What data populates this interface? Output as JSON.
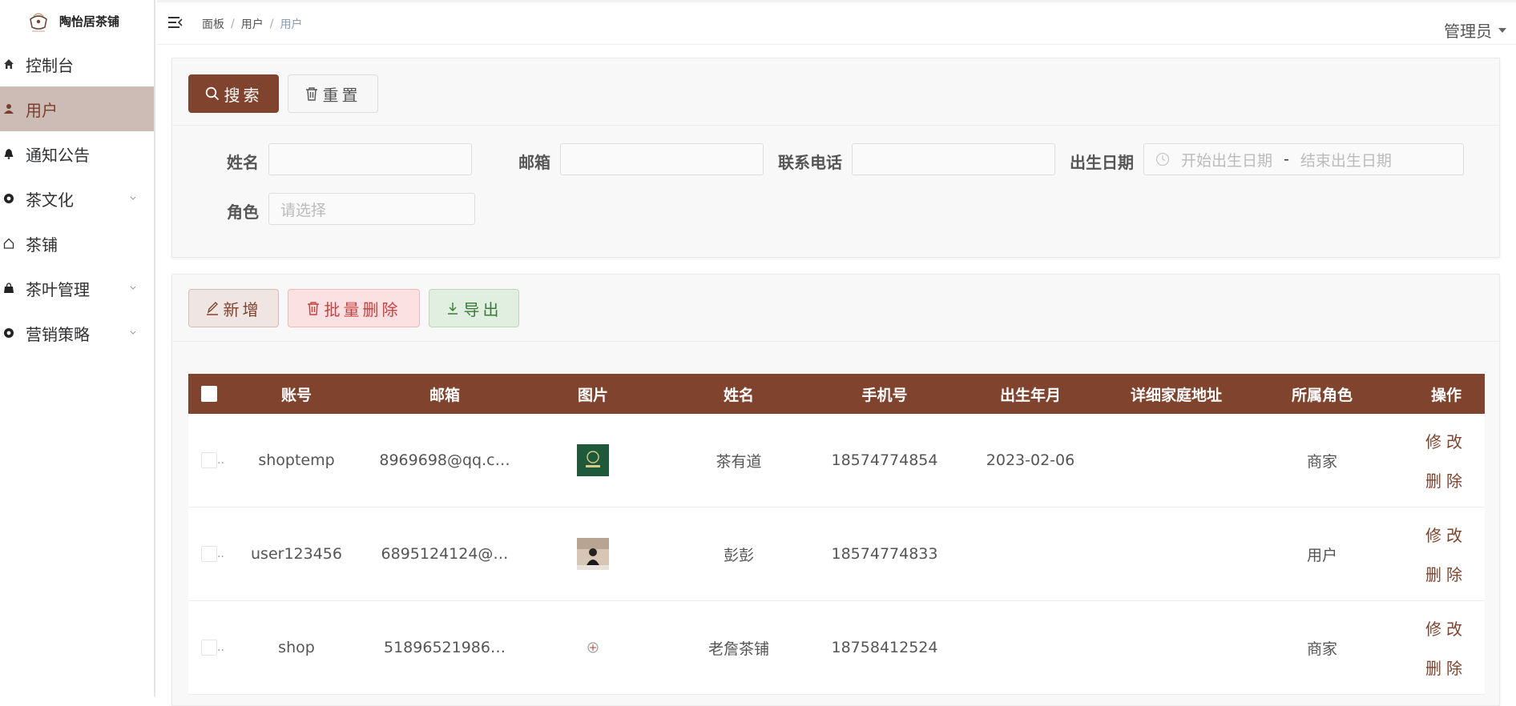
{
  "app": {
    "name": "陶怡居茶铺"
  },
  "sidebar": {
    "items": [
      {
        "label": "控制台",
        "icon": "home-icon",
        "active": false,
        "submenu": false
      },
      {
        "label": "用户",
        "icon": "user-icon",
        "active": true,
        "submenu": false
      },
      {
        "label": "通知公告",
        "icon": "bell-icon",
        "active": false,
        "submenu": false
      },
      {
        "label": "茶文化",
        "icon": "circle-icon",
        "active": false,
        "submenu": true
      },
      {
        "label": "茶铺",
        "icon": "house-icon",
        "active": false,
        "submenu": false
      },
      {
        "label": "茶叶管理",
        "icon": "bag-icon",
        "active": false,
        "submenu": true
      },
      {
        "label": "营销策略",
        "icon": "circle-icon",
        "active": false,
        "submenu": true
      }
    ]
  },
  "header": {
    "breadcrumb": [
      "面板",
      "用户",
      "用户"
    ],
    "user": "管理员"
  },
  "search": {
    "search_label": "搜索",
    "reset_label": "重置",
    "fields": {
      "name_label": "姓名",
      "email_label": "邮箱",
      "phone_label": "联系电话",
      "birth_label": "出生日期",
      "birth_start_placeholder": "开始出生日期",
      "birth_end_placeholder": "结束出生日期",
      "birth_separator": "-",
      "role_label": "角色",
      "role_placeholder": "请选择"
    }
  },
  "toolbar": {
    "add_label": "新增",
    "batch_delete_label": "批量删除",
    "export_label": "导出"
  },
  "table": {
    "columns": [
      "账号",
      "邮箱",
      "图片",
      "姓名",
      "手机号",
      "出生年月",
      "详细家庭地址",
      "所属角色",
      "操作"
    ],
    "rows": [
      {
        "account": "shoptemp",
        "email": "8969698@qq.c…",
        "name": "茶有道",
        "phone": "18574774854",
        "birth": "2023-02-06",
        "address": "",
        "role": "商家",
        "thumb": "green"
      },
      {
        "account": "user123456",
        "email": "6895124124@…",
        "name": "彭彭",
        "phone": "18574774833",
        "birth": "",
        "address": "",
        "role": "用户",
        "thumb": "photo"
      },
      {
        "account": "shop",
        "email": "51896521986…",
        "name": "老詹茶铺",
        "phone": "18758412524",
        "birth": "",
        "address": "",
        "role": "商家",
        "thumb": "light"
      }
    ],
    "edit_label": "修改",
    "delete_label": "删除",
    "row_check_ellipsis": ".."
  },
  "colors": {
    "primary": "#80432d",
    "active_menu_bg": "#cdbcb6"
  }
}
